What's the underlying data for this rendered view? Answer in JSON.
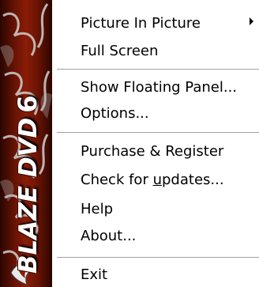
{
  "brand": {
    "text": "BLAZE DVD",
    "version": "6",
    "colors": {
      "dark": "#2a0500",
      "mid": "#8a1c07",
      "flame": "#c8c8c8"
    }
  },
  "menu": {
    "items": [
      {
        "label": "Picture In Picture",
        "has_submenu": true
      },
      {
        "label": "Full Screen"
      },
      {
        "label": "Show Floating Panel..."
      },
      {
        "label": "Options..."
      },
      {
        "label": "Purchase & Register"
      },
      {
        "label_before": "Check for ",
        "label_underlined": "u",
        "label_after": "pdates..."
      },
      {
        "label": "Help"
      },
      {
        "label": "About..."
      },
      {
        "label": "Exit"
      }
    ]
  }
}
